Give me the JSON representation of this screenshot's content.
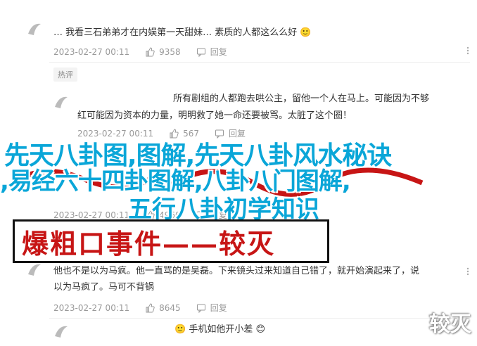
{
  "comments": [
    {
      "text_lines": [
        "… 我看三石弟弟才在内娱第一天甜妹… 素质的人都这么么好 🙂"
      ],
      "date": "2023-02-27 00:11",
      "likes": "9358",
      "reply_label": "回复"
    },
    {
      "tag": "热评",
      "text_lines": [
        "所有剧组的人都跑去哄公主，留他一个人在马上。可能因为不够",
        "红可能因为资本的力量，明明救了她一命还要被骂。太脏了这个圈！"
      ],
      "date": "2023-02-27 00:11",
      "likes": "567",
      "reply_label": "回复"
    },
    {
      "date": "2023-02-27 00:11",
      "likes": "4960",
      "reply_label": "回复"
    },
    {
      "text_lines": [
        "他也不是以为马疯。他一直骂的是吴磊。下来镜头过来知道自己错了，就开始演起来了，说",
        "以为马疯了。马可不背锅"
      ],
      "date": "2023-02-27 00:11",
      "likes": "8645",
      "reply_label": "回复"
    },
    {
      "text_lines": [
        "🙂 手机如他开小差 😊"
      ]
    }
  ],
  "overlay": {
    "line1": "先天八卦图,图解,先天八卦风水秘诀",
    "line2": ",易经六十四卦图解,八卦八门图解,",
    "line3": "五行八卦初学知识"
  },
  "banner_text": "爆粗口事件——较灭",
  "watermark": "较灭",
  "colors": {
    "overlay": "#0aa6d8",
    "banner": "#c71515",
    "meta": "#999999"
  }
}
